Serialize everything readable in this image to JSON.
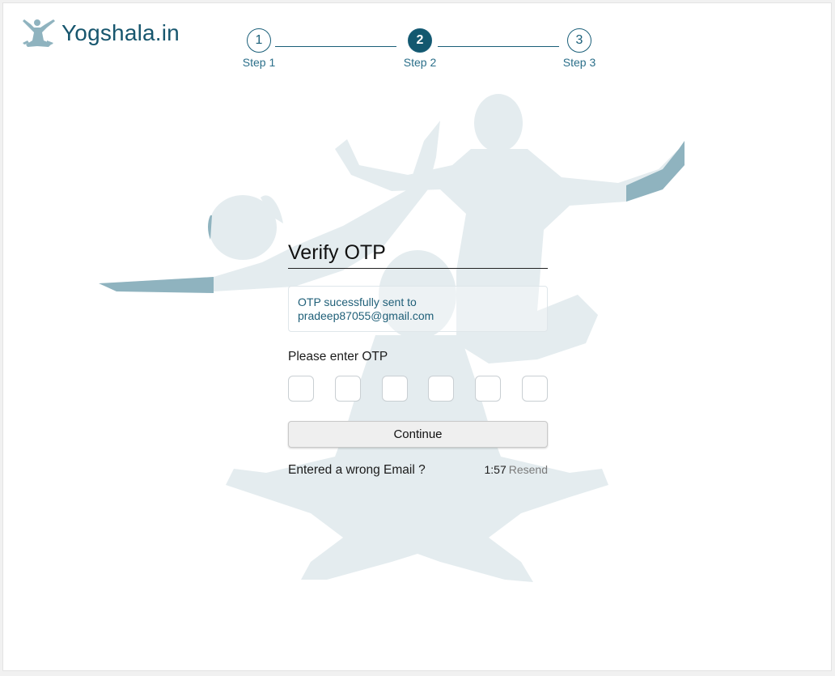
{
  "brand": {
    "name": "Yogshala.in",
    "icon": "meditating-figure-logo-icon",
    "color": "#17566e"
  },
  "stepper": {
    "steps": [
      {
        "number": "1",
        "label": "Step 1",
        "state": "completed"
      },
      {
        "number": "2",
        "label": "Step 2",
        "state": "active"
      },
      {
        "number": "3",
        "label": "Step 3",
        "state": "upcoming"
      }
    ],
    "active_color": "#13586f"
  },
  "background": {
    "illustration": "yoga-poses-silhouette",
    "color": "#e4ecef"
  },
  "form": {
    "title": "Verify OTP",
    "notice_line1": "OTP sucessfully sent to",
    "notice_email": "pradeep87055@gmail.com",
    "otp_label": "Please enter OTP",
    "otp_digits": [
      "",
      "",
      "",
      "",
      "",
      ""
    ],
    "continue_label": "Continue",
    "wrong_email_text": "Entered a wrong Email ?",
    "timer": "1:57",
    "resend_label": "Resend"
  }
}
